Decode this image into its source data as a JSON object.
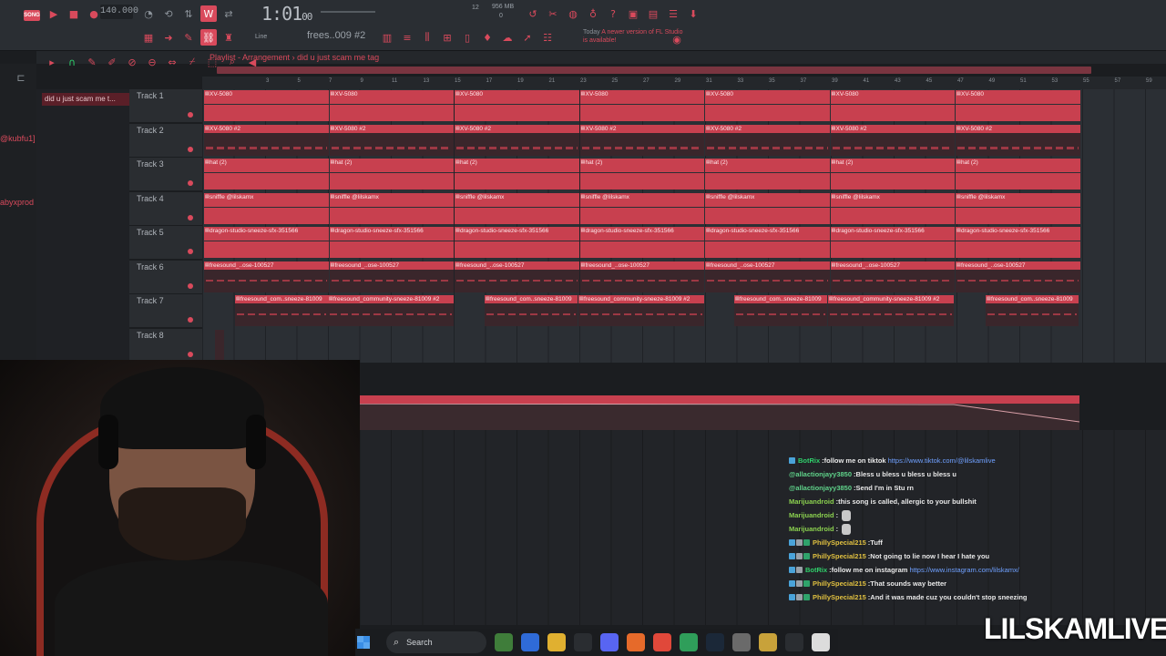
{
  "toolbar": {
    "song_chip": "SONG",
    "tempo": "140.000",
    "time_main": "1:01",
    "time_sub": "00",
    "cpu_number": "12",
    "memory": "956 MB",
    "memory_num": "0",
    "line_mode": "Line",
    "pattern": "frees..009 #2",
    "news_day": "Today",
    "news_text": "A newer version of FL Studio is available!"
  },
  "playlist": {
    "title": "Playlist - Arrangement",
    "separator": "›",
    "arrangement": "did u just scam me tag",
    "ruler_ticks": [
      "3",
      "5",
      "7",
      "9",
      "11",
      "13",
      "15",
      "17",
      "19",
      "21",
      "23",
      "25",
      "27",
      "29",
      "31",
      "33",
      "35",
      "37",
      "39",
      "41",
      "43",
      "45",
      "47",
      "49",
      "51",
      "53",
      "55",
      "57",
      "59",
      "61"
    ]
  },
  "browser": {
    "users": [
      "@kubfu1]",
      "abyxprod"
    ]
  },
  "picker": {
    "item": "did u just scam me t..."
  },
  "tracks": [
    {
      "name": "Track 1"
    },
    {
      "name": "Track 2"
    },
    {
      "name": "Track 3"
    },
    {
      "name": "Track 4"
    },
    {
      "name": "Track 5"
    },
    {
      "name": "Track 6"
    },
    {
      "name": "Track 7"
    },
    {
      "name": "Track 8"
    }
  ],
  "clip_names": {
    "t1": "XV-5080",
    "t2": "XV-5080 #2",
    "t3": "hat (2)",
    "t4": "sniffle @lilskamx",
    "t5": "dragon-studio-sneeze-sfx-351566",
    "t6": "freesound_..ose-100527",
    "t7a": "freesound_com..sneeze-81009",
    "t7b": "freesound_community-sneeze-81009 #2"
  },
  "automation": {
    "label": "Volume"
  },
  "chat": [
    {
      "badges": 1,
      "user": "BotRix",
      "user_color": "#2fd06b",
      "text": "follow me on tiktok",
      "link": "https://www.tiktok.com/@lilskamlive"
    },
    {
      "badges": 0,
      "user": "@allactionjayy3850",
      "user_color": "#5fd38a",
      "text": "Bless u bless u bless u bless u"
    },
    {
      "badges": 0,
      "user": "@allactionjayy3850",
      "user_color": "#5fd38a",
      "text": "Send I'm in Stu rn"
    },
    {
      "badges": 0,
      "user": "Marijuandroid",
      "user_color": "#8bd14f",
      "text": "this song is called, allergic to your bullshit"
    },
    {
      "badges": 0,
      "user": "Marijuandroid",
      "user_color": "#8bd14f",
      "text": "",
      "emote": true
    },
    {
      "badges": 0,
      "user": "Marijuandroid",
      "user_color": "#8bd14f",
      "text": "",
      "emote": true
    },
    {
      "badges": 3,
      "user": "PhillySpecial215",
      "user_color": "#e0c040",
      "text": "Tuff"
    },
    {
      "badges": 3,
      "user": "PhillySpecial215",
      "user_color": "#e0c040",
      "text": "Not going to lie now I hear I hate you"
    },
    {
      "badges": 2,
      "user": "BotRix",
      "user_color": "#2fd06b",
      "text": "follow me on instagram",
      "link": "https://www.instagram.com/lilskamx/"
    },
    {
      "badges": 3,
      "user": "PhillySpecial215",
      "user_color": "#e0c040",
      "text": "That sounds way better"
    },
    {
      "badges": 3,
      "user": "PhillySpecial215",
      "user_color": "#e0c040",
      "text": "And it was made cuz you couldn't stop sneezing"
    }
  ],
  "taskbar": {
    "search_label": "Search",
    "apps": [
      "widgets-app",
      "copilot-app",
      "file-explorer-app",
      "store-app",
      "discord-app",
      "firefox-app",
      "brave-app",
      "chrome-app",
      "steam-app",
      "dj-app",
      "stack-app",
      "4k-app",
      "capcut-app"
    ]
  },
  "brand": "LILSKAMLIVE",
  "colors": {
    "accent": "#d94a5c",
    "clip": "#c8404f",
    "bg": "#1b1d20"
  }
}
